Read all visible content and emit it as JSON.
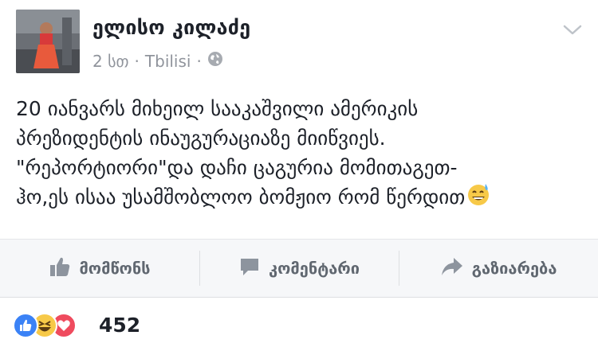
{
  "post": {
    "author": "ელისო კილაძე",
    "time": "2 სთ",
    "separator1": "·",
    "location": "Tbilisi",
    "separator2": "·",
    "privacy_icon": "globe-icon",
    "lines": [
      "20 იანვარს მიხეილ სააკაშვილი ამერიკის",
      "პრეზიდენტის ინაუგურაციაზე მიიწვიეს.",
      "\"რეპორტიორი\"და დაჩი ცაგურია მომითაგეთ-",
      "ჰო,ეს ისაა უსამშობლოო ბომჟიო რომ წერდით"
    ],
    "emoji": "sweat-smile-emoji"
  },
  "actions": {
    "like": {
      "label": "მომწონს",
      "icon": "thumbs-up-icon"
    },
    "comment": {
      "label": "კომენტარი",
      "icon": "comment-icon"
    },
    "share": {
      "label": "გაზიარება",
      "icon": "share-icon"
    }
  },
  "reactions": {
    "types": [
      "like",
      "haha",
      "love"
    ],
    "count": "452",
    "colors": {
      "like": "#3b82f6",
      "haha": "#f7c948",
      "love": "#ef4b5e"
    }
  }
}
